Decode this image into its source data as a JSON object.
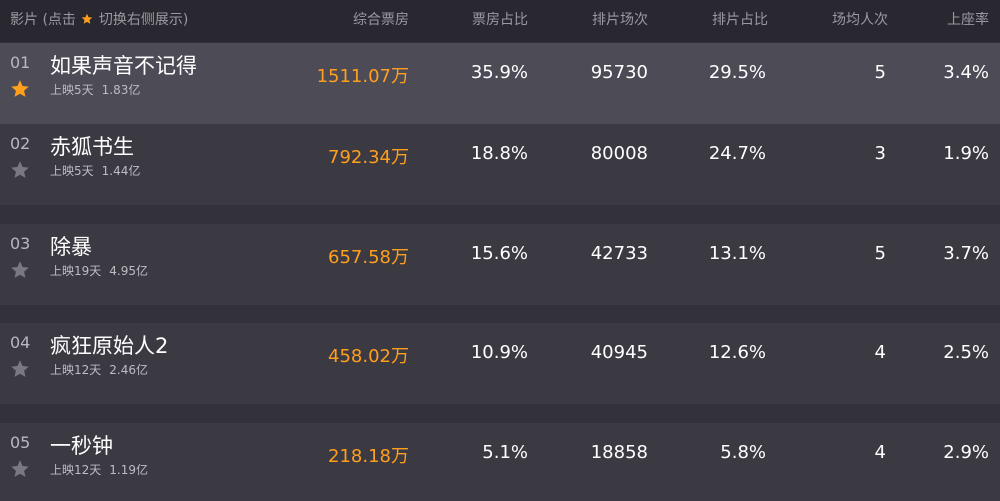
{
  "header": {
    "film_prefix": "影片 (点击",
    "film_suffix": "切换右侧展示)",
    "total": "综合票房",
    "share": "票房占比",
    "shows": "排片场次",
    "show_share": "排片占比",
    "avg": "场均人次",
    "occupancy": "上座率"
  },
  "colors": {
    "accent": "#ff9f1c",
    "row_active": "#4c4b56",
    "row": "#3b3a43",
    "header_bg": "#292830"
  },
  "rows": [
    {
      "rank": "01",
      "title": "如果声音不记得",
      "days": "上映5天",
      "cum": "1.83亿",
      "total": "1511.07万",
      "share": "35.9%",
      "shows": "95730",
      "show_share": "29.5%",
      "avg": "5",
      "occupancy": "3.4%",
      "starred": true
    },
    {
      "rank": "02",
      "title": "赤狐书生",
      "days": "上映5天",
      "cum": "1.44亿",
      "total": "792.34万",
      "share": "18.8%",
      "shows": "80008",
      "show_share": "24.7%",
      "avg": "3",
      "occupancy": "1.9%",
      "starred": false
    },
    {
      "rank": "03",
      "title": "除暴",
      "days": "上映19天",
      "cum": "4.95亿",
      "total": "657.58万",
      "share": "15.6%",
      "shows": "42733",
      "show_share": "13.1%",
      "avg": "5",
      "occupancy": "3.7%",
      "starred": false
    },
    {
      "rank": "04",
      "title": "疯狂原始人2",
      "days": "上映12天",
      "cum": "2.46亿",
      "total": "458.02万",
      "share": "10.9%",
      "shows": "40945",
      "show_share": "12.6%",
      "avg": "4",
      "occupancy": "2.5%",
      "starred": false
    },
    {
      "rank": "05",
      "title": "一秒钟",
      "days": "上映12天",
      "cum": "1.19亿",
      "total": "218.18万",
      "share": "5.1%",
      "shows": "18858",
      "show_share": "5.8%",
      "avg": "4",
      "occupancy": "2.9%",
      "starred": false
    }
  ]
}
